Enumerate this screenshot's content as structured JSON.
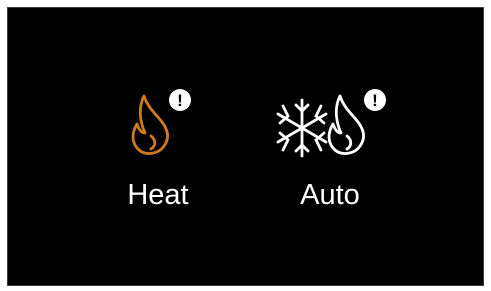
{
  "modes": [
    {
      "label": "Heat",
      "icon": "flame-alert-icon",
      "icon_color": "#d17a1c",
      "alert": "!"
    },
    {
      "label": "Auto",
      "icon": "snowflake-flame-alert-icon",
      "icon_color": "#ffffff",
      "alert": "!"
    }
  ],
  "colors": {
    "background": "#000000",
    "text": "#ffffff",
    "heat_accent": "#d17a1c"
  }
}
